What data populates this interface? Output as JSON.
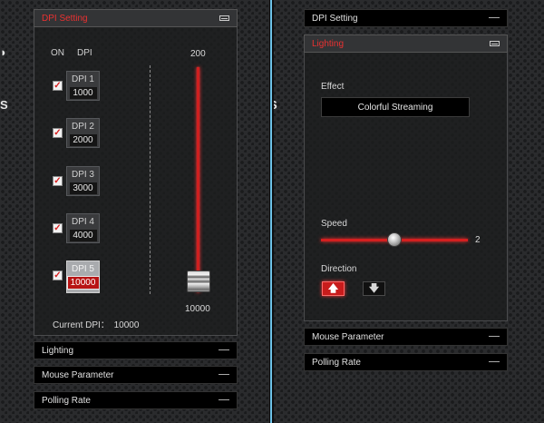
{
  "left_panel": {
    "sections": {
      "dpi_setting": "DPI Setting",
      "lighting": "Lighting",
      "mouse_parameter": "Mouse Parameter",
      "polling_rate": "Polling Rate"
    },
    "dpi": {
      "header_on": "ON",
      "header_dpi": "DPI",
      "levels": [
        {
          "label": "DPI 1",
          "value": "1000",
          "checked": true,
          "active": false
        },
        {
          "label": "DPI 2",
          "value": "2000",
          "checked": true,
          "active": false
        },
        {
          "label": "DPI 3",
          "value": "3000",
          "checked": true,
          "active": false
        },
        {
          "label": "DPI 4",
          "value": "4000",
          "checked": true,
          "active": false
        },
        {
          "label": "DPI 5",
          "value": "10000",
          "checked": true,
          "active": true
        }
      ],
      "check_mark": "✓",
      "slider_top": "200",
      "slider_bottom": "10000",
      "current_label": "Current DPI：",
      "current_value": "10000"
    }
  },
  "right_panel": {
    "sections": {
      "dpi_setting": "DPI Setting",
      "lighting": "Lighting",
      "mouse_parameter": "Mouse Parameter",
      "polling_rate": "Polling Rate"
    },
    "lighting": {
      "effect_label": "Effect",
      "effect_value": "Colorful Streaming",
      "speed_label": "Speed",
      "speed_value": "2",
      "direction_label": "Direction",
      "up_glyph": "🡅",
      "down_glyph": "🡇"
    }
  },
  "colors": {
    "accent": "#d41f1f",
    "accent_text": "#ea3131",
    "divider": "#5ab6df",
    "panel_header_open": "#333436",
    "bar_bg": "#000000"
  }
}
